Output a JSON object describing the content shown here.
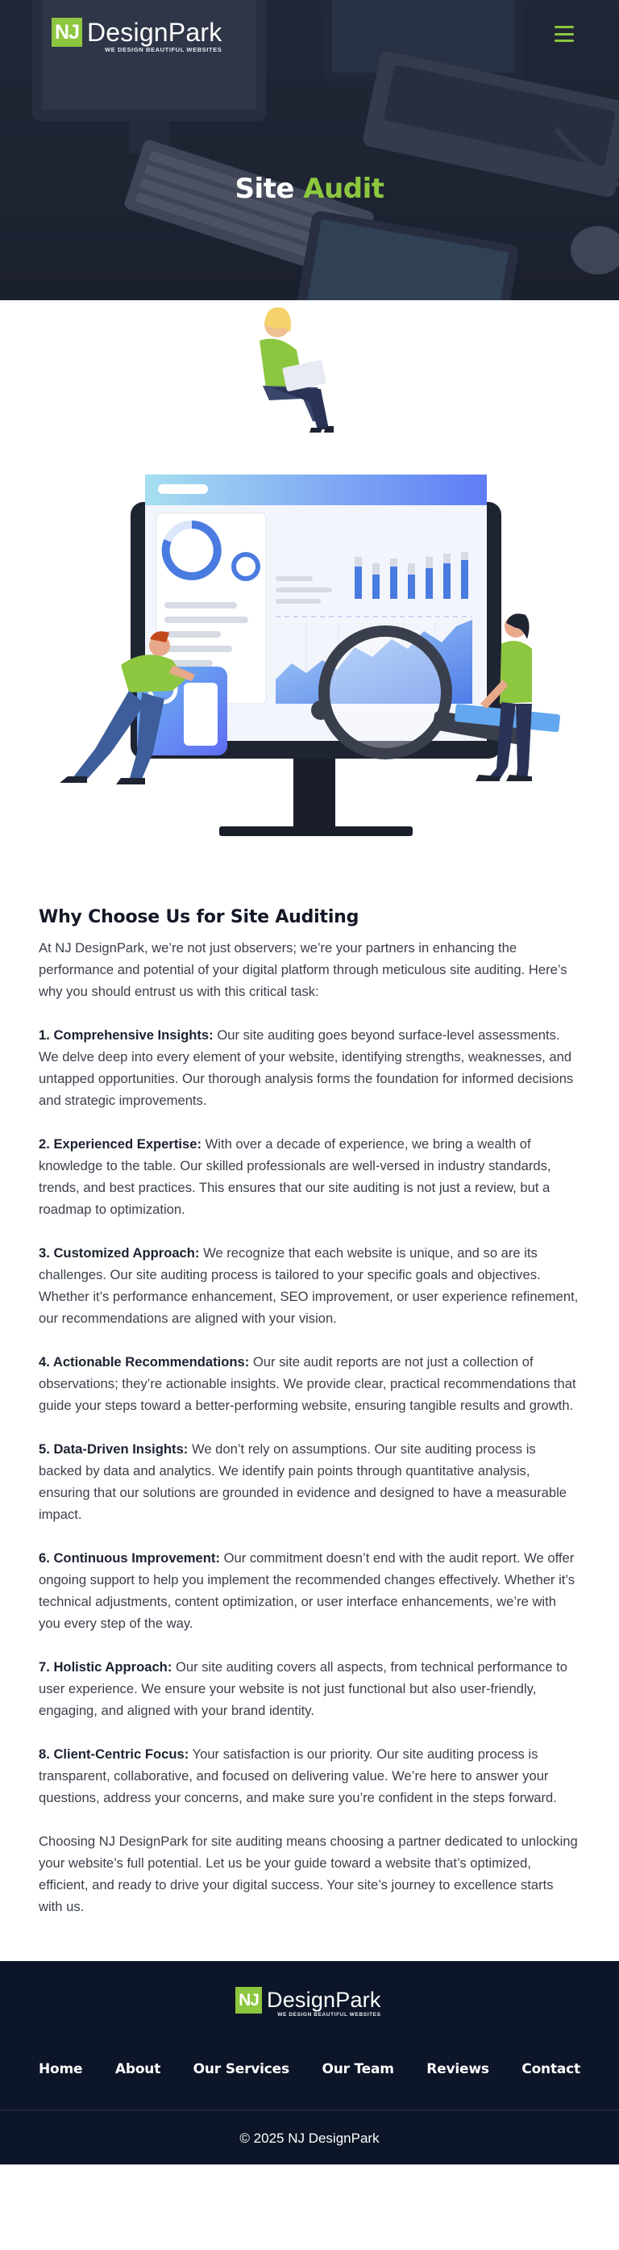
{
  "brand": {
    "logo_initials": "NJ",
    "logo_name": "DesignPark",
    "logo_tagline": "WE DESIGN BEAUTIFUL WEBSITES",
    "accent_color": "#8dc63f",
    "footer_bg": "#0d1528"
  },
  "hero": {
    "title_main": "Site",
    "title_accent": "Audit",
    "menu_icon": "hamburger-menu-icon"
  },
  "illustration": {
    "icon": "site-audit-illustration"
  },
  "content": {
    "heading": "Why Choose Us for Site Auditing",
    "intro": "At NJ DesignPark, we’re not just observers; we’re your partners in enhancing the performance and potential of your digital platform through meticulous site auditing. Here’s why you should entrust us with this critical task:",
    "points": [
      {
        "title": "1. Comprehensive Insights:",
        "text": " Our site auditing goes beyond surface-level assessments. We delve deep into every element of your website, identifying strengths, weaknesses, and untapped opportunities. Our thorough analysis forms the foundation for informed decisions and strategic improvements."
      },
      {
        "title": "2. Experienced Expertise:",
        "text": " With over a decade of experience, we bring a wealth of knowledge to the table. Our skilled professionals are well-versed in industry standards, trends, and best practices. This ensures that our site auditing is not just a review, but a roadmap to optimization."
      },
      {
        "title": "3. Customized Approach:",
        "text": " We recognize that each website is unique, and so are its challenges. Our site auditing process is tailored to your specific goals and objectives. Whether it’s performance enhancement, SEO improvement, or user experience refinement, our recommendations are aligned with your vision."
      },
      {
        "title": "4. Actionable Recommendations:",
        "text": " Our site audit reports are not just a collection of observations; they’re actionable insights. We provide clear, practical recommendations that guide your steps toward a better-performing website, ensuring tangible results and growth."
      },
      {
        "title": "5. Data-Driven Insights:",
        "text": " We don’t rely on assumptions. Our site auditing process is backed by data and analytics. We identify pain points through quantitative analysis, ensuring that our solutions are grounded in evidence and designed to have a measurable impact."
      },
      {
        "title": "6. Continuous Improvement:",
        "text": " Our commitment doesn’t end with the audit report. We offer ongoing support to help you implement the recommended changes effectively. Whether it’s technical adjustments, content optimization, or user interface enhancements, we’re with you every step of the way."
      },
      {
        "title": "7. Holistic Approach:",
        "text": " Our site auditing covers all aspects, from technical performance to user experience. We ensure your website is not just functional but also user-friendly, engaging, and aligned with your brand identity."
      },
      {
        "title": "8. Client-Centric Focus:",
        "text": " Your satisfaction is our priority. Our site auditing process is transparent, collaborative, and focused on delivering value. We’re here to answer your questions, address your concerns, and make sure you’re confident in the steps forward."
      }
    ],
    "closing": "Choosing NJ DesignPark for site auditing means choosing a partner dedicated to unlocking your website’s full potential. Let us be your guide toward a website that’s optimized, efficient, and ready to drive your digital success. Your site’s journey to excellence starts with us."
  },
  "footer": {
    "nav": [
      "Home",
      "About",
      "Our Services",
      "Our Team",
      "Reviews",
      "Contact"
    ],
    "copyright": "© 2025 NJ DesignPark"
  }
}
